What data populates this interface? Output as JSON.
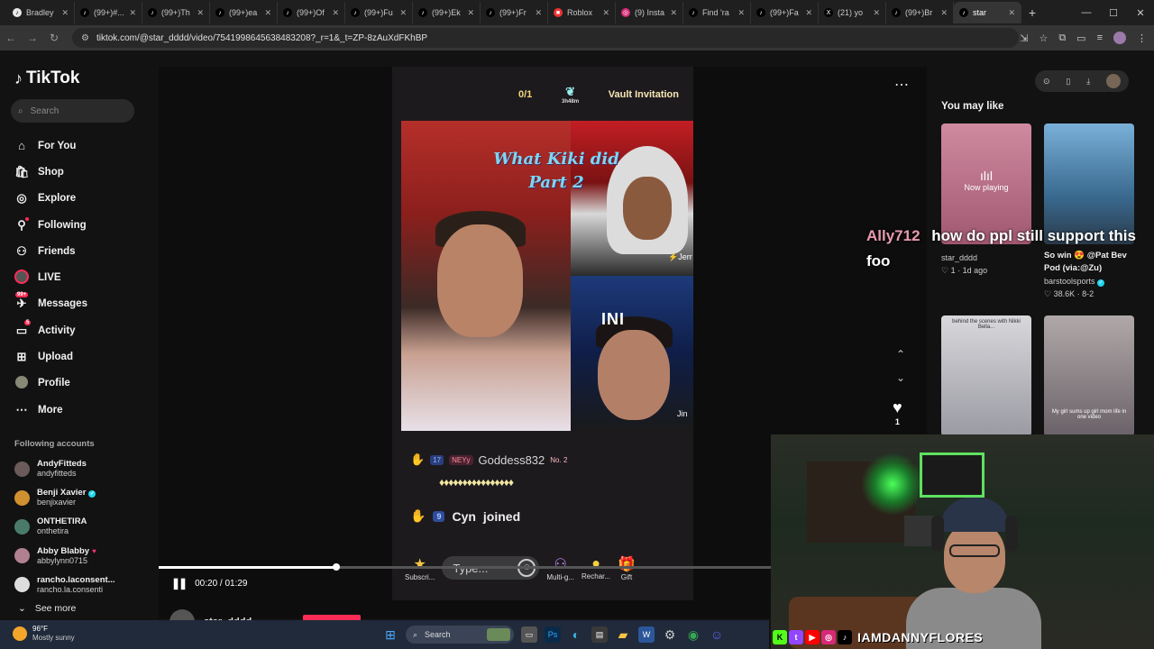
{
  "browser": {
    "tabs": [
      {
        "label": "Bradley",
        "icon": "b"
      },
      {
        "label": "(99+)#...",
        "icon": "t"
      },
      {
        "label": "(99+)Th",
        "icon": "t"
      },
      {
        "label": "(99+)ea",
        "icon": "t"
      },
      {
        "label": "(99+)Of",
        "icon": "t"
      },
      {
        "label": "(99+)Fu",
        "icon": "t"
      },
      {
        "label": "(99+)Ek",
        "icon": "t"
      },
      {
        "label": "(99+)Fr",
        "icon": "t"
      },
      {
        "label": "Roblox",
        "icon": "r"
      },
      {
        "label": "(9) Insta",
        "icon": "i"
      },
      {
        "label": "Find 'ra",
        "icon": "t"
      },
      {
        "label": "(99+)Fa",
        "icon": "t"
      },
      {
        "label": "(21) yo",
        "icon": "x"
      },
      {
        "label": "(99+)Br",
        "icon": "t"
      },
      {
        "label": "star",
        "icon": "t"
      }
    ],
    "url": "tiktok.com/@star_dddd/video/7541998645638483208?_r=1&_t=ZP-8zAuXdFKhBP"
  },
  "sidebar": {
    "logo": "TikTok",
    "search_placeholder": "Search",
    "nav": [
      {
        "label": "For You",
        "icon": "home-icon"
      },
      {
        "label": "Shop",
        "icon": "shop-icon"
      },
      {
        "label": "Explore",
        "icon": "compass-icon"
      },
      {
        "label": "Following",
        "icon": "following-icon"
      },
      {
        "label": "Friends",
        "icon": "friends-icon"
      },
      {
        "label": "LIVE",
        "icon": "live-icon"
      },
      {
        "label": "Messages",
        "icon": "messages-icon",
        "badge": "99+"
      },
      {
        "label": "Activity",
        "icon": "activity-icon",
        "badge": "5"
      },
      {
        "label": "Upload",
        "icon": "upload-icon"
      },
      {
        "label": "Profile",
        "icon": "profile-icon"
      },
      {
        "label": "More",
        "icon": "more-icon"
      }
    ],
    "following_header": "Following accounts",
    "accounts": [
      {
        "name": "AndyFitteds",
        "username": "andyfitteds"
      },
      {
        "name": "Benji Xavier",
        "username": "benjixavier"
      },
      {
        "name": "ONTHETIRA",
        "username": "onthetira"
      },
      {
        "name": "Abby Blabby",
        "username": "abbylynn0715"
      },
      {
        "name": "rancho.laconsent...",
        "username": "rancho.la.consenti"
      }
    ],
    "see_more": "See more"
  },
  "video": {
    "top_count": "0/1",
    "timer": "3h48m",
    "vault": "Vault Invitation",
    "title_line1": "What Kiki did",
    "title_line2": "Part 2",
    "tag_right": "⚡Jerr",
    "tag_ini": "INI",
    "tag_jin": "Jin",
    "chat_level": "17",
    "chat_chip": "NEYy",
    "chat_user": "Goddess832",
    "chat_rank": "No. 2",
    "chat_dots": "♦♦♦♦♦♦♦♦♦♦♦♦♦♦♦♦",
    "join_level": "9",
    "join_user": "Cyn",
    "join_text": "joined",
    "type_placeholder": "Type...",
    "bottom_items": [
      "Subscri...",
      "Multi-g...",
      "Rechar...",
      "Gift"
    ],
    "time": "00:20 / 01:29",
    "progress": 0.29,
    "author": "star_dddd",
    "likes": "1"
  },
  "right_panel": {
    "header": "You may like",
    "cards": [
      {
        "title": "",
        "sub": "star_dddd",
        "stats": "♡ 1 · 1d ago",
        "now_playing": "Now playing",
        "color": "#c87890"
      },
      {
        "title": "So win 😍 @Pat Bev Pod (via:@Zu)",
        "sub": "barstoolsports",
        "stats": "♡ 38.6K · 8-2",
        "color": "#5a86b0"
      },
      {
        "title": "",
        "sub": "",
        "stats": "",
        "overlay": "behind the scenes with Nikki Bella...",
        "color": "#b8b8c0"
      },
      {
        "title": "",
        "sub": "",
        "stats": "",
        "overlay": "My girl sums up girl mom life in one video",
        "color": "#8a8a92"
      }
    ]
  },
  "overlay_chat": {
    "user": "Ally712",
    "message": "how do ppl still support this foo"
  },
  "streamer": {
    "handle": "IAMDANNYFLORES"
  },
  "taskbar": {
    "temp": "96°F",
    "cond": "Mostly sunny",
    "search": "Search"
  }
}
